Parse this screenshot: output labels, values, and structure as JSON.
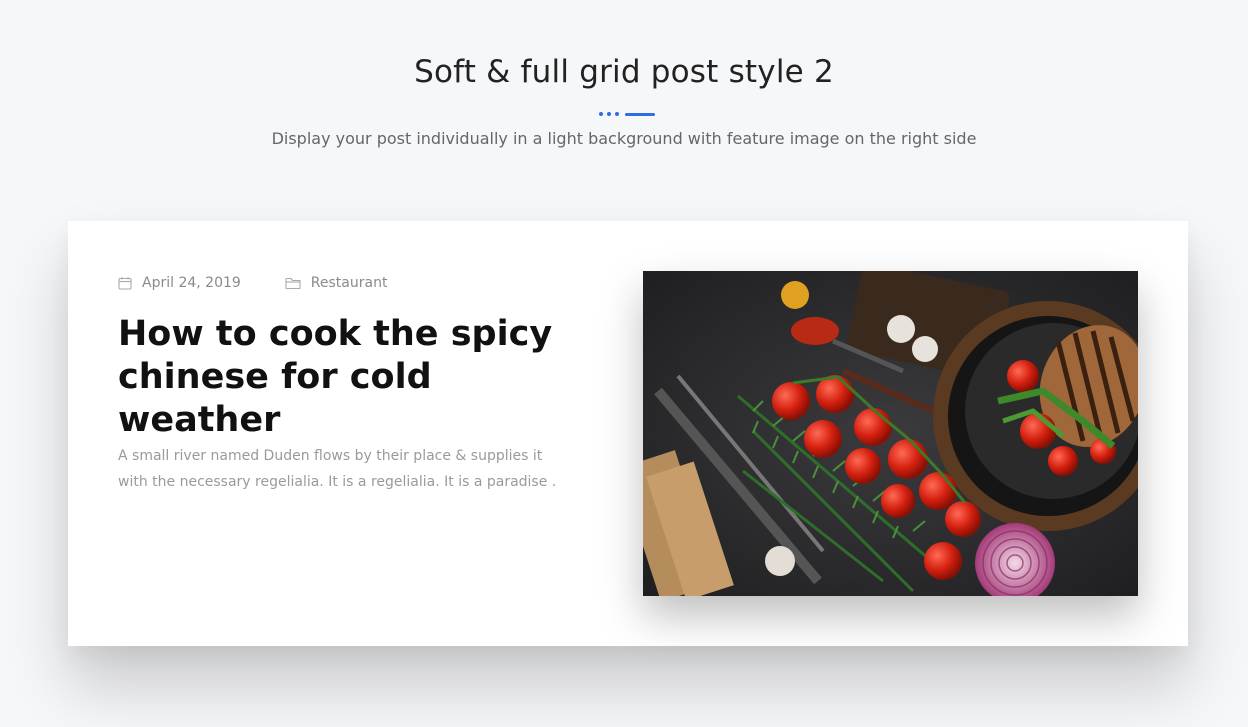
{
  "header": {
    "title": "Soft & full grid post style 2",
    "subtitle": "Display your post individually in a light background with feature image on the right side"
  },
  "post": {
    "date": "April 24, 2019",
    "category": "Restaurant",
    "title": "How to cook the spicy chinese for cold weather",
    "excerpt": "A small river named Duden flows by their place & supplies it with the necessary regelialia. It is a regelialia. It is a paradise ."
  },
  "icons": {
    "date": "calendar-icon",
    "category": "folder-icon"
  },
  "colors": {
    "accent": "#2e6fe0",
    "page_background": "#f6f7f9",
    "card_background": "#ffffff"
  }
}
